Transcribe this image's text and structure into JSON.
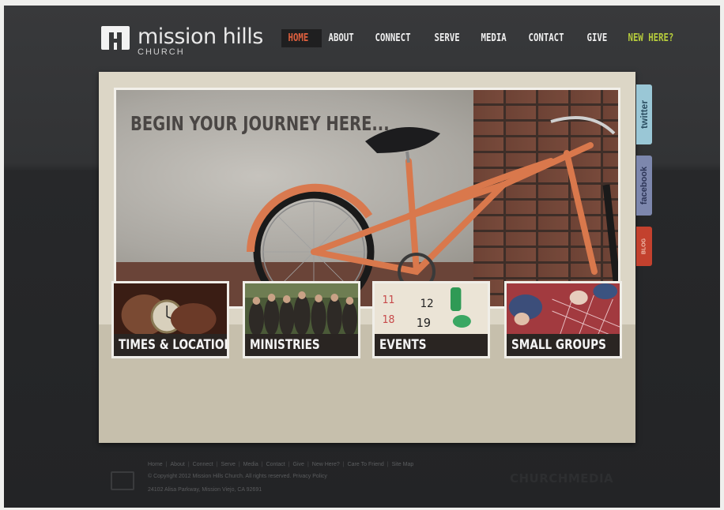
{
  "header": {
    "logo_title": "mission hills",
    "logo_subtitle": "CHURCH",
    "nav": [
      "HOME",
      "ABOUT",
      "CONNECT",
      "SERVE",
      "MEDIA",
      "CONTACT",
      "GIVE",
      "NEW HERE?"
    ],
    "active_nav": "HOME"
  },
  "hero": {
    "title": "BEGIN YOUR JOURNEY HERE...",
    "slide_count": 3,
    "active_slide": 2
  },
  "tiles": [
    {
      "label": "TIMES & LOCATION"
    },
    {
      "label": "MINISTRIES"
    },
    {
      "label": "EVENTS"
    },
    {
      "label": "SMALL GROUPS"
    }
  ],
  "social": {
    "twitter": "twitter",
    "facebook": "facebook",
    "blog": "BLOG"
  },
  "footer": {
    "links": [
      "Home",
      "About",
      "Connect",
      "Serve",
      "Media",
      "Contact",
      "Give",
      "New Here?",
      "Care To Friend",
      "Site Map"
    ],
    "copyright": "© Copyright 2012 Mission Hills Church. All rights reserved.  Privacy Policy",
    "address": "24102 Alisa Parkway, Mission Viejo, CA 92691",
    "brand": "CHURCHMEDIA"
  },
  "colors": {
    "accent_active": "#e0603e",
    "accent_new": "#b6cc3c",
    "twitter": "#9ac7d6",
    "facebook": "#7d87ad",
    "blog": "#c3412e"
  }
}
